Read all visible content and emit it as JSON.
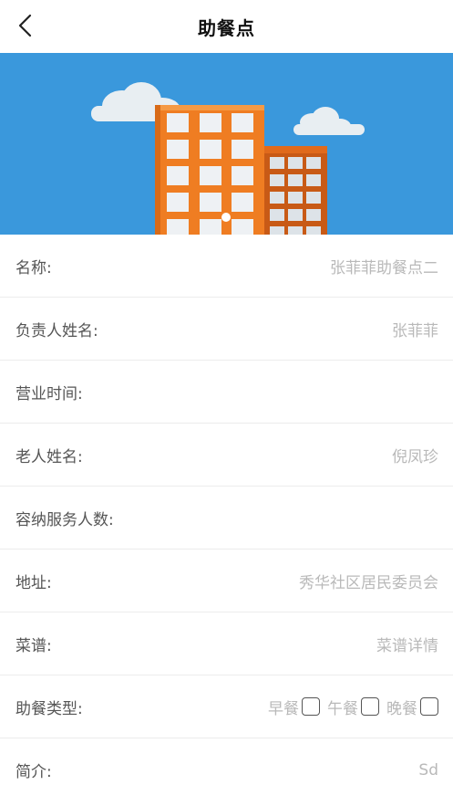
{
  "nav": {
    "title": "助餐点",
    "back_icon": "chevron-left-icon"
  },
  "banner": {
    "sky_color": "#3a98dc",
    "building_color": "#ef7d22"
  },
  "fields": {
    "name": {
      "label": "名称:",
      "value": "张菲菲助餐点二"
    },
    "manager": {
      "label": "负责人姓名:",
      "value": "张菲菲"
    },
    "hours": {
      "label": "营业时间:",
      "value": ""
    },
    "elder": {
      "label": "老人姓名:",
      "value": "倪凤珍"
    },
    "capacity": {
      "label": "容纳服务人数:",
      "value": ""
    },
    "address": {
      "label": "地址:",
      "value": "秀华社区居民委员会"
    },
    "menu": {
      "label": "菜谱:",
      "value": "菜谱详情"
    },
    "meal_type": {
      "label": "助餐类型:",
      "options": [
        {
          "label": "早餐",
          "checked": false
        },
        {
          "label": "午餐",
          "checked": false
        },
        {
          "label": "晚餐",
          "checked": false
        }
      ]
    },
    "intro": {
      "label": "简介:",
      "value": "Sd"
    }
  }
}
